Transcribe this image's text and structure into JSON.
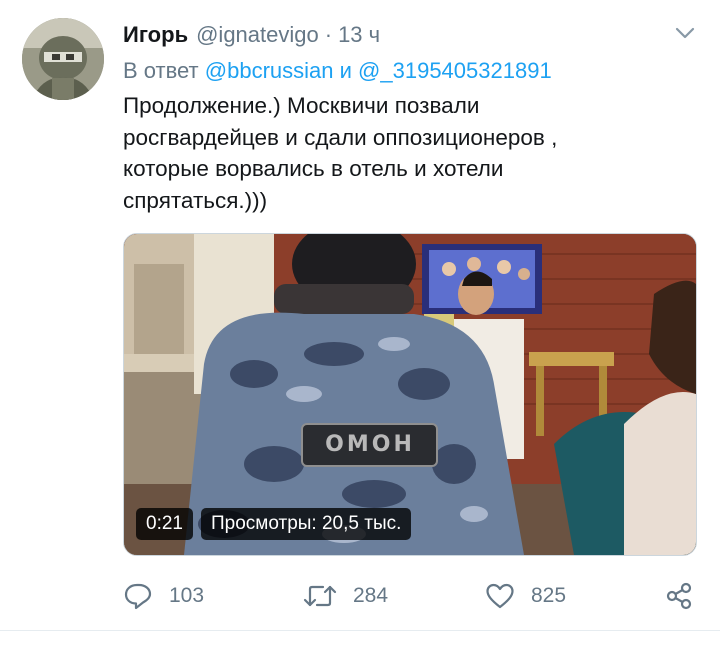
{
  "tweet": {
    "author_name": "Игорь",
    "author_handle": "@ignatevigo",
    "separator": "·",
    "timestamp": "13 ч",
    "reply_prefix": "В ответ",
    "reply_mention_1": "@bbcrussian",
    "reply_conj": "и",
    "reply_mention_2": "@_3195405321891",
    "text": "Продолжение.) Москвичи позвали\nросгвардейцев и сдали оппозиционеров ,\nкоторые ворвались в отель и хотели\nспрятаться.)))"
  },
  "media": {
    "duration": "0:21",
    "views": "Просмотры: 20,5 тыс.",
    "patch_text": "ОМОН"
  },
  "actions": {
    "replies": "103",
    "retweets": "284",
    "likes": "825"
  },
  "icons": {
    "menu": "chevron-down-icon",
    "reply": "reply-icon",
    "retweet": "retweet-icon",
    "like": "heart-icon",
    "share": "share-icon"
  },
  "colors": {
    "link": "#1da1f2",
    "secondary": "#657786",
    "primary_text": "#14171a"
  }
}
